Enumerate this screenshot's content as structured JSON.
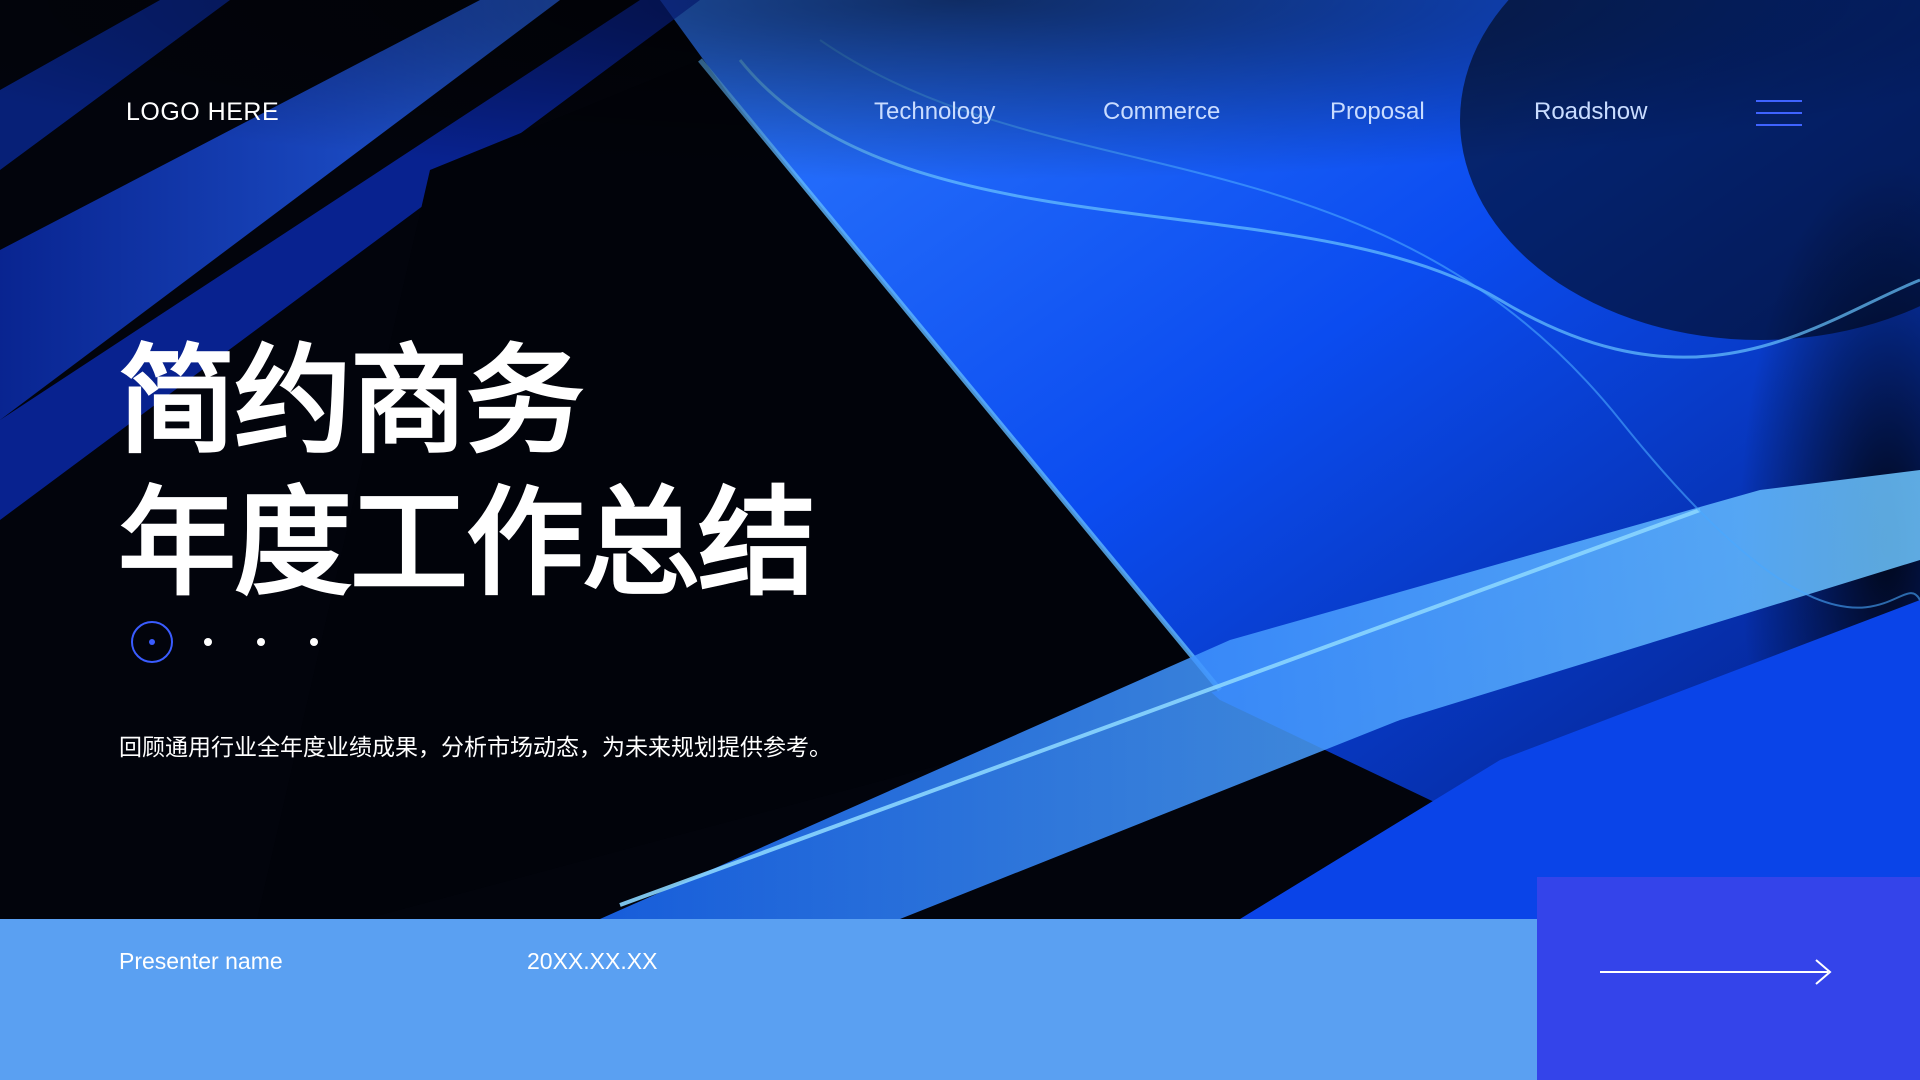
{
  "nav": {
    "logo": "LOGO HERE",
    "items": [
      "Technology",
      "Commerce",
      "Proposal",
      "Roadshow"
    ]
  },
  "title": {
    "line1": "简约商务",
    "line2": "年度工作总结"
  },
  "subtitle": "回顾通用行业全年度业绩成果，分析市场动态，为未来规划提供参考。",
  "footer": {
    "presenter": "Presenter name",
    "date": "20XX.XX.XX"
  },
  "icons": {
    "menu": "hamburger-menu-icon",
    "next": "arrow-right-icon"
  },
  "colors": {
    "accent": "#3444ea",
    "footer_bar": "#5aa0f2",
    "menu_lines": "#3f63ff"
  }
}
